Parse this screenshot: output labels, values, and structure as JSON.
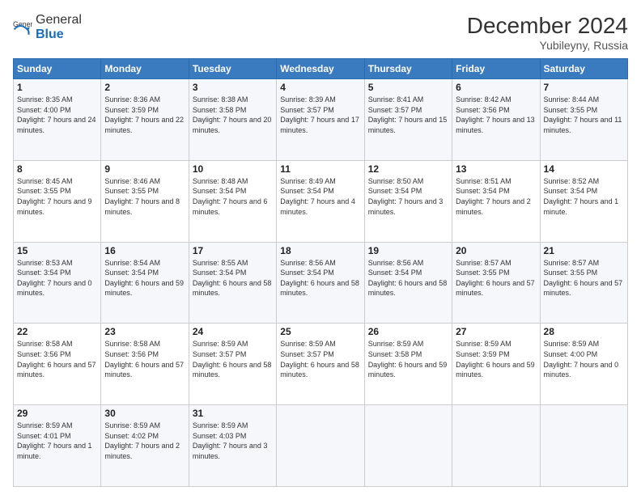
{
  "logo": {
    "general": "General",
    "blue": "Blue"
  },
  "title": {
    "month_year": "December 2024",
    "location": "Yubileyny, Russia"
  },
  "calendar": {
    "headers": [
      "Sunday",
      "Monday",
      "Tuesday",
      "Wednesday",
      "Thursday",
      "Friday",
      "Saturday"
    ],
    "weeks": [
      [
        null,
        null,
        null,
        null,
        {
          "day": "5",
          "sunrise": "8:41 AM",
          "sunset": "3:57 PM",
          "daylight": "7 hours and 15 minutes."
        },
        {
          "day": "6",
          "sunrise": "8:42 AM",
          "sunset": "3:56 PM",
          "daylight": "7 hours and 13 minutes."
        },
        {
          "day": "7",
          "sunrise": "8:44 AM",
          "sunset": "3:55 PM",
          "daylight": "7 hours and 11 minutes."
        }
      ],
      [
        {
          "day": "1",
          "sunrise": "8:35 AM",
          "sunset": "4:00 PM",
          "daylight": "7 hours and 24 minutes."
        },
        {
          "day": "2",
          "sunrise": "8:36 AM",
          "sunset": "3:59 PM",
          "daylight": "7 hours and 22 minutes."
        },
        {
          "day": "3",
          "sunrise": "8:38 AM",
          "sunset": "3:58 PM",
          "daylight": "7 hours and 20 minutes."
        },
        {
          "day": "4",
          "sunrise": "8:39 AM",
          "sunset": "3:57 PM",
          "daylight": "7 hours and 17 minutes."
        },
        {
          "day": "5",
          "sunrise": "8:41 AM",
          "sunset": "3:57 PM",
          "daylight": "7 hours and 15 minutes."
        },
        {
          "day": "6",
          "sunrise": "8:42 AM",
          "sunset": "3:56 PM",
          "daylight": "7 hours and 13 minutes."
        },
        {
          "day": "7",
          "sunrise": "8:44 AM",
          "sunset": "3:55 PM",
          "daylight": "7 hours and 11 minutes."
        }
      ],
      [
        {
          "day": "8",
          "sunrise": "8:45 AM",
          "sunset": "3:55 PM",
          "daylight": "7 hours and 9 minutes."
        },
        {
          "day": "9",
          "sunrise": "8:46 AM",
          "sunset": "3:55 PM",
          "daylight": "7 hours and 8 minutes."
        },
        {
          "day": "10",
          "sunrise": "8:48 AM",
          "sunset": "3:54 PM",
          "daylight": "7 hours and 6 minutes."
        },
        {
          "day": "11",
          "sunrise": "8:49 AM",
          "sunset": "3:54 PM",
          "daylight": "7 hours and 4 minutes."
        },
        {
          "day": "12",
          "sunrise": "8:50 AM",
          "sunset": "3:54 PM",
          "daylight": "7 hours and 3 minutes."
        },
        {
          "day": "13",
          "sunrise": "8:51 AM",
          "sunset": "3:54 PM",
          "daylight": "7 hours and 2 minutes."
        },
        {
          "day": "14",
          "sunrise": "8:52 AM",
          "sunset": "3:54 PM",
          "daylight": "7 hours and 1 minute."
        }
      ],
      [
        {
          "day": "15",
          "sunrise": "8:53 AM",
          "sunset": "3:54 PM",
          "daylight": "7 hours and 0 minutes."
        },
        {
          "day": "16",
          "sunrise": "8:54 AM",
          "sunset": "3:54 PM",
          "daylight": "6 hours and 59 minutes."
        },
        {
          "day": "17",
          "sunrise": "8:55 AM",
          "sunset": "3:54 PM",
          "daylight": "6 hours and 58 minutes."
        },
        {
          "day": "18",
          "sunrise": "8:56 AM",
          "sunset": "3:54 PM",
          "daylight": "6 hours and 58 minutes."
        },
        {
          "day": "19",
          "sunrise": "8:56 AM",
          "sunset": "3:54 PM",
          "daylight": "6 hours and 58 minutes."
        },
        {
          "day": "20",
          "sunrise": "8:57 AM",
          "sunset": "3:55 PM",
          "daylight": "6 hours and 57 minutes."
        },
        {
          "day": "21",
          "sunrise": "8:57 AM",
          "sunset": "3:55 PM",
          "daylight": "6 hours and 57 minutes."
        }
      ],
      [
        {
          "day": "22",
          "sunrise": "8:58 AM",
          "sunset": "3:56 PM",
          "daylight": "6 hours and 57 minutes."
        },
        {
          "day": "23",
          "sunrise": "8:58 AM",
          "sunset": "3:56 PM",
          "daylight": "6 hours and 57 minutes."
        },
        {
          "day": "24",
          "sunrise": "8:59 AM",
          "sunset": "3:57 PM",
          "daylight": "6 hours and 58 minutes."
        },
        {
          "day": "25",
          "sunrise": "8:59 AM",
          "sunset": "3:57 PM",
          "daylight": "6 hours and 58 minutes."
        },
        {
          "day": "26",
          "sunrise": "8:59 AM",
          "sunset": "3:58 PM",
          "daylight": "6 hours and 59 minutes."
        },
        {
          "day": "27",
          "sunrise": "8:59 AM",
          "sunset": "3:59 PM",
          "daylight": "6 hours and 59 minutes."
        },
        {
          "day": "28",
          "sunrise": "8:59 AM",
          "sunset": "4:00 PM",
          "daylight": "7 hours and 0 minutes."
        }
      ],
      [
        {
          "day": "29",
          "sunrise": "8:59 AM",
          "sunset": "4:01 PM",
          "daylight": "7 hours and 1 minute."
        },
        {
          "day": "30",
          "sunrise": "8:59 AM",
          "sunset": "4:02 PM",
          "daylight": "7 hours and 2 minutes."
        },
        {
          "day": "31",
          "sunrise": "8:59 AM",
          "sunset": "4:03 PM",
          "daylight": "7 hours and 3 minutes."
        },
        null,
        null,
        null,
        null
      ]
    ]
  }
}
